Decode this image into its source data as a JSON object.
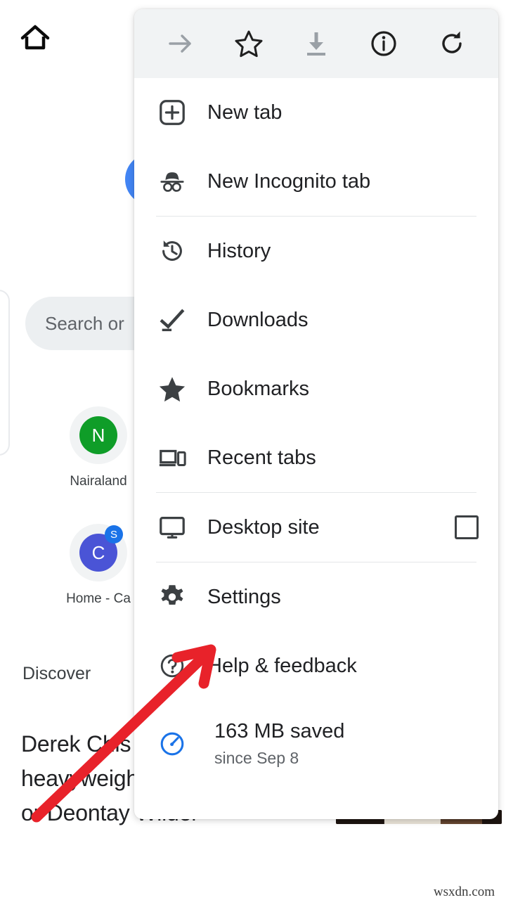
{
  "background": {
    "home_icon": "home-icon",
    "search": {
      "placeholder": "Search or"
    },
    "shortcuts": [
      {
        "letter": "N",
        "label": "Nairaland",
        "color": "#0f9d28",
        "badge": ""
      },
      {
        "letter": "C",
        "label": "Home - Ca",
        "color": "#4a54d6",
        "badge": "S"
      }
    ],
    "discover_label": "Discover",
    "article_headline": "Derek Chis 'mental' lis five heavyweights no Oleksandr Usyk or Deontay Wilder",
    "watermark": "wsxdn.com"
  },
  "menu": {
    "toolbar": [
      {
        "name": "forward-arrow-icon",
        "label": "Forward",
        "enabled": false
      },
      {
        "name": "star-icon",
        "label": "Bookmark",
        "enabled": true
      },
      {
        "name": "download-icon",
        "label": "Download page",
        "enabled": false
      },
      {
        "name": "info-icon",
        "label": "Page info",
        "enabled": true
      },
      {
        "name": "reload-icon",
        "label": "Reload",
        "enabled": true
      }
    ],
    "items": [
      {
        "id": "new-tab",
        "icon": "new-tab-icon",
        "label": "New tab"
      },
      {
        "id": "new-incognito-tab",
        "icon": "incognito-icon",
        "label": "New Incognito tab"
      },
      {
        "id": "history",
        "icon": "history-icon",
        "label": "History"
      },
      {
        "id": "downloads",
        "icon": "downloads-check-icon",
        "label": "Downloads"
      },
      {
        "id": "bookmarks",
        "icon": "star-filled-icon",
        "label": "Bookmarks"
      },
      {
        "id": "recent-tabs",
        "icon": "devices-icon",
        "label": "Recent tabs"
      },
      {
        "id": "desktop-site",
        "icon": "monitor-icon",
        "label": "Desktop site",
        "checkbox": false
      },
      {
        "id": "settings",
        "icon": "gear-icon",
        "label": "Settings"
      },
      {
        "id": "help-feedback",
        "icon": "help-circle-icon",
        "label": "Help & feedback"
      }
    ],
    "data_saver": {
      "icon": "speedometer-icon",
      "primary": "163 MB saved",
      "secondary": "since Sep 8",
      "accent_color": "#1a73e8"
    }
  },
  "annotation": {
    "arrow_color": "#e8222a",
    "points_at": "Settings"
  }
}
